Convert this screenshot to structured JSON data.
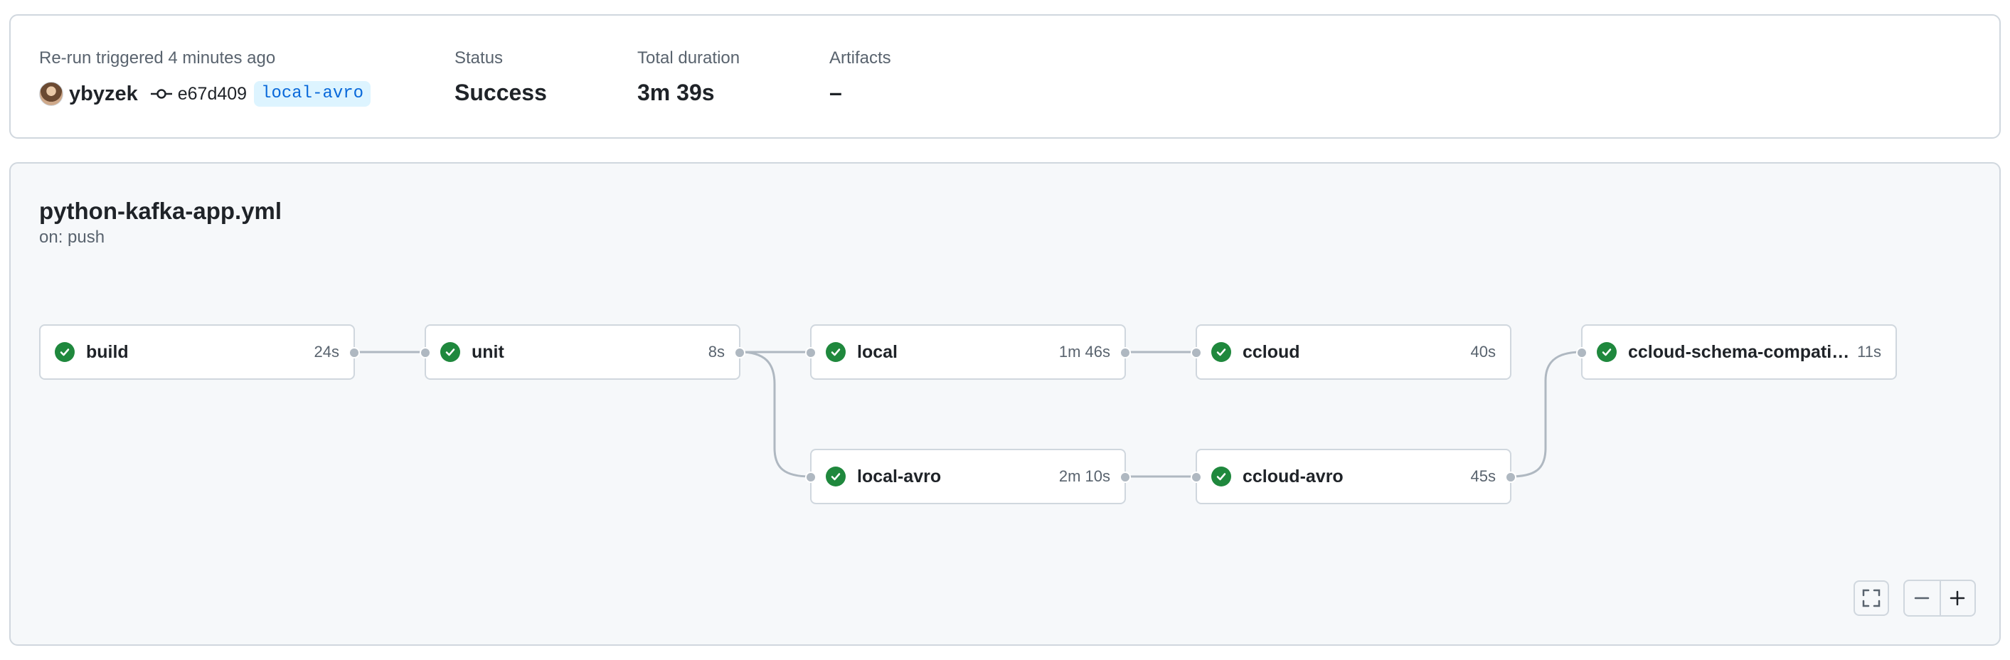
{
  "summary": {
    "trigger_text": "Re-run triggered 4 minutes ago",
    "username": "ybyzek",
    "commit_sha": "e67d409",
    "branch": "local-avro",
    "status_label": "Status",
    "status_value": "Success",
    "duration_label": "Total duration",
    "duration_value": "3m 39s",
    "artifacts_label": "Artifacts",
    "artifacts_value": "–"
  },
  "workflow": {
    "file": "python-kafka-app.yml",
    "trigger": "on: push",
    "jobs": [
      {
        "name": "build",
        "duration": "24s",
        "status": "success"
      },
      {
        "name": "unit",
        "duration": "8s",
        "status": "success"
      },
      {
        "name": "local",
        "duration": "1m 46s",
        "status": "success"
      },
      {
        "name": "ccloud",
        "duration": "40s",
        "status": "success"
      },
      {
        "name": "ccloud-schema-compatibi...",
        "duration": "11s",
        "status": "success"
      },
      {
        "name": "local-avro",
        "duration": "2m 10s",
        "status": "success"
      },
      {
        "name": "ccloud-avro",
        "duration": "45s",
        "status": "success"
      }
    ]
  },
  "colors": {
    "success": "#1f883d",
    "link": "#0969da",
    "border": "#d0d7de",
    "canvas": "#f6f8fa"
  },
  "icons": {
    "commit": "git-commit-icon",
    "check": "check-circle-icon",
    "fullscreen": "fullscreen-icon",
    "zoom_out": "minus-icon",
    "zoom_in": "plus-icon"
  }
}
